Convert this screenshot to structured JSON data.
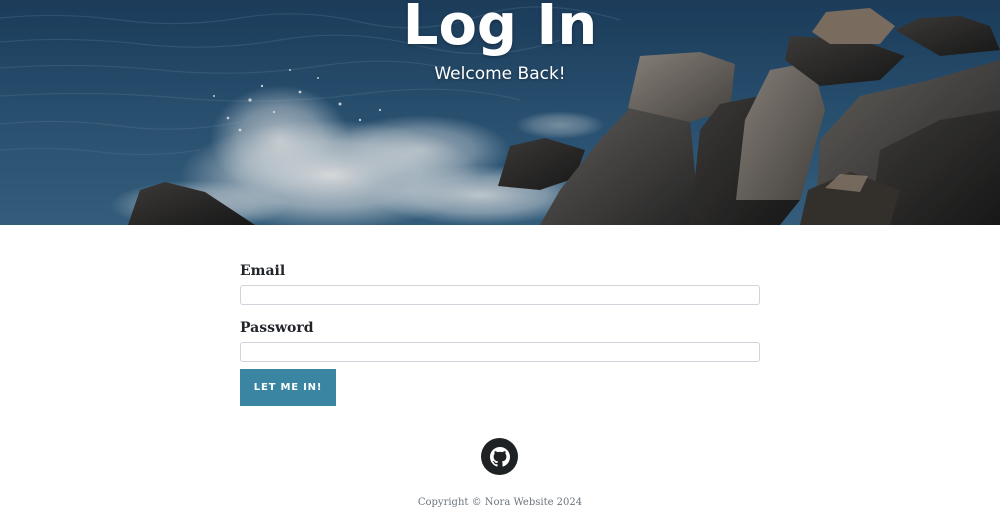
{
  "hero": {
    "title": "Log In",
    "subtitle": "Welcome Back!",
    "background": "ocean-waves-crashing-on-rocks-photo"
  },
  "form": {
    "email_label": "Email",
    "email_value": "",
    "password_label": "Password",
    "password_value": "",
    "submit_label": "LET ME IN!"
  },
  "footer": {
    "github_icon": "github-icon",
    "copyright": "Copyright © Nora Website 2024"
  },
  "colors": {
    "accent": "#3a85a1",
    "icon_circle": "#1e2225",
    "muted_text": "#6c757d"
  }
}
